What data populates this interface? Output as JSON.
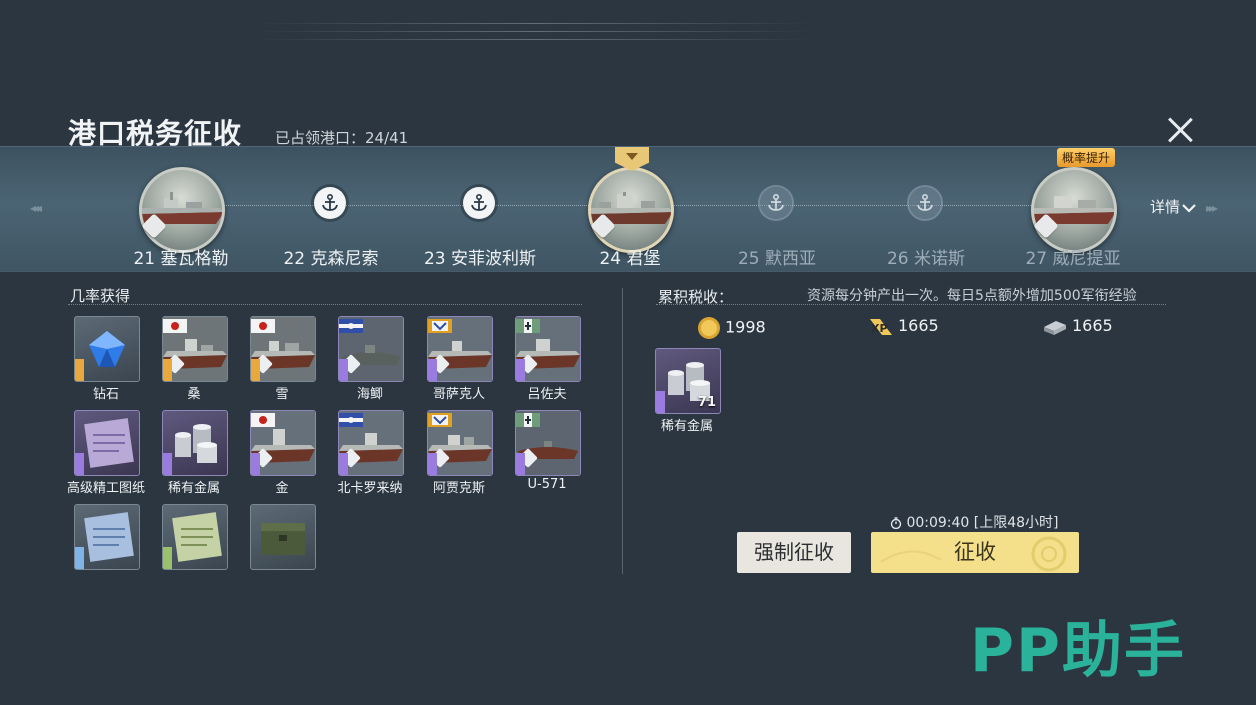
{
  "header": {
    "title": "港口税务征收",
    "occupied": "已占领港口：24/41",
    "close_label": "×"
  },
  "ports": [
    {
      "label": "21 塞瓦格勒",
      "state": "captured_ship"
    },
    {
      "label": "22 克森尼索",
      "state": "captured"
    },
    {
      "label": "23 安菲波利斯",
      "state": "captured"
    },
    {
      "label": "24 君堡",
      "state": "current_ship"
    },
    {
      "label": "25 默西亚",
      "state": "locked"
    },
    {
      "label": "26 米诺斯",
      "state": "locked"
    },
    {
      "label": "27 威尼提亚",
      "state": "locked_ship"
    }
  ],
  "strip": {
    "rate_badge": "概率提升",
    "details": "详情",
    "arrow_left": "◂◂◂",
    "arrow_right": "▸▸▸"
  },
  "drops": {
    "title": "几率获得",
    "items": [
      {
        "name": "钻石",
        "kind": "diamond",
        "rarity": "gold"
      },
      {
        "name": "桑",
        "kind": "ship",
        "rarity": "gold",
        "flag": "jp"
      },
      {
        "name": "雪",
        "kind": "ship",
        "rarity": "gold",
        "flag": "jp"
      },
      {
        "name": "海鲫",
        "kind": "ship",
        "rarity": "purple",
        "flag": "us"
      },
      {
        "name": "哥萨克人",
        "kind": "ship",
        "rarity": "purple",
        "flag": "uk"
      },
      {
        "name": "吕佐夫",
        "kind": "ship",
        "rarity": "purple",
        "flag": "de"
      },
      {
        "name": "高级精工图纸",
        "kind": "blueprint",
        "rarity": "purple"
      },
      {
        "name": "稀有金属",
        "kind": "metal",
        "rarity": "purple"
      },
      {
        "name": "金",
        "kind": "ship",
        "rarity": "purple",
        "flag": "jp"
      },
      {
        "name": "北卡罗来纳",
        "kind": "ship",
        "rarity": "purple",
        "flag": "us"
      },
      {
        "name": "阿贾克斯",
        "kind": "ship",
        "rarity": "purple",
        "flag": "uk"
      },
      {
        "name": "U-571",
        "kind": "ship",
        "rarity": "purple",
        "flag": "de"
      },
      {
        "name": "",
        "kind": "blueprint",
        "rarity": "blue"
      },
      {
        "name": "",
        "kind": "blueprint",
        "rarity": "green"
      },
      {
        "name": "",
        "kind": "crate",
        "rarity": "plain"
      }
    ]
  },
  "tax": {
    "title": "累积税收：",
    "description": "资源每分钟产出一次。每日5点额外增加500军衔经验",
    "resources": [
      {
        "icon": "gold-coin-icon",
        "value": "1998"
      },
      {
        "icon": "xp-icon",
        "value": "1665"
      },
      {
        "icon": "steel-icon",
        "value": "1665"
      }
    ],
    "reward": {
      "name": "稀有金属",
      "count": "71"
    },
    "timer": "00:09:40 [上限48小时]",
    "force_button": "强制征收",
    "collect_button": "征收"
  },
  "watermark": "PP助手",
  "colors": {
    "accent_gold": "#f4e08a",
    "rarity_purple": "#9a7be0",
    "rarity_gold": "#e8a83c",
    "watermark": "#2ab29a"
  }
}
